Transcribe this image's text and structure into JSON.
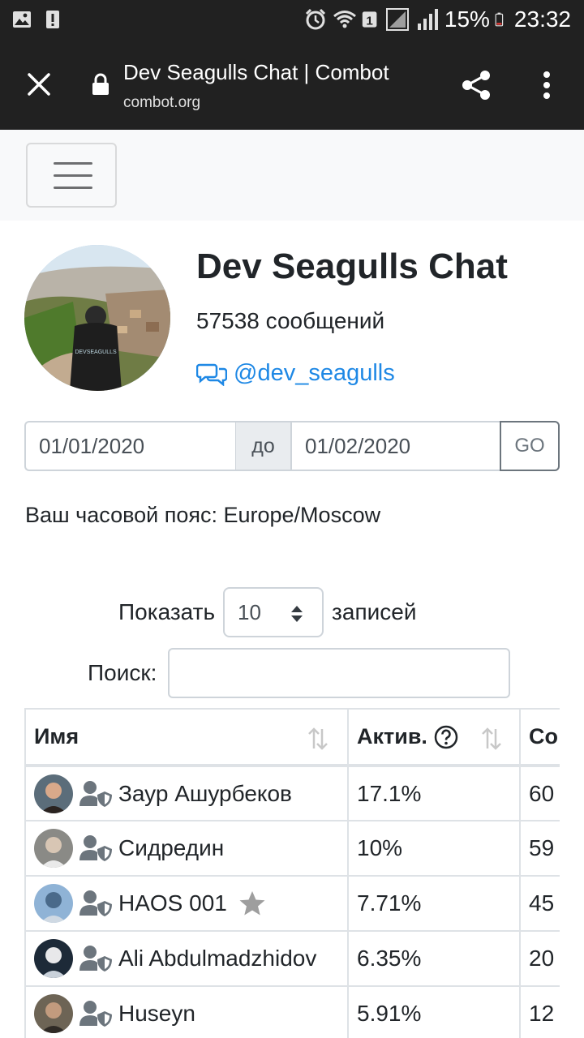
{
  "status_bar": {
    "battery": "15%",
    "time": "23:32",
    "sim_badge": "1"
  },
  "browser": {
    "title": "Dev Seagulls Chat | Combot",
    "url": "combot.org"
  },
  "chat": {
    "title": "Dev Seagulls Chat",
    "message_count": "57538 сообщений",
    "handle": "@dev_seagulls"
  },
  "date_filter": {
    "from": "01/01/2020",
    "separator": "до",
    "to": "01/02/2020",
    "go_label": "GO"
  },
  "timezone": "Ваш часовой пояс: Europe/Moscow",
  "table_controls": {
    "show_label": "Показать",
    "page_size": "10",
    "records_label": "записей",
    "search_label": "Поиск:",
    "search_value": ""
  },
  "table": {
    "headers": [
      "Имя",
      "Актив.",
      "Со"
    ],
    "rows": [
      {
        "name": "Заур Ашурбеков",
        "activity": "17.1%",
        "count": "60",
        "star": false
      },
      {
        "name": "Сидредин",
        "activity": "10%",
        "count": "59",
        "star": false
      },
      {
        "name": "HAOS 001",
        "activity": "7.71%",
        "count": "45",
        "star": true
      },
      {
        "name": "Ali Abdulmadzhidov",
        "activity": "6.35%",
        "count": "20",
        "star": false
      },
      {
        "name": "Huseyn",
        "activity": "5.91%",
        "count": "12",
        "star": false
      }
    ]
  },
  "colors": {
    "toolbar_bg": "#212121",
    "link": "#1e88e5",
    "navbar_bg": "#f8f9fa",
    "border": "#dee2e6"
  }
}
